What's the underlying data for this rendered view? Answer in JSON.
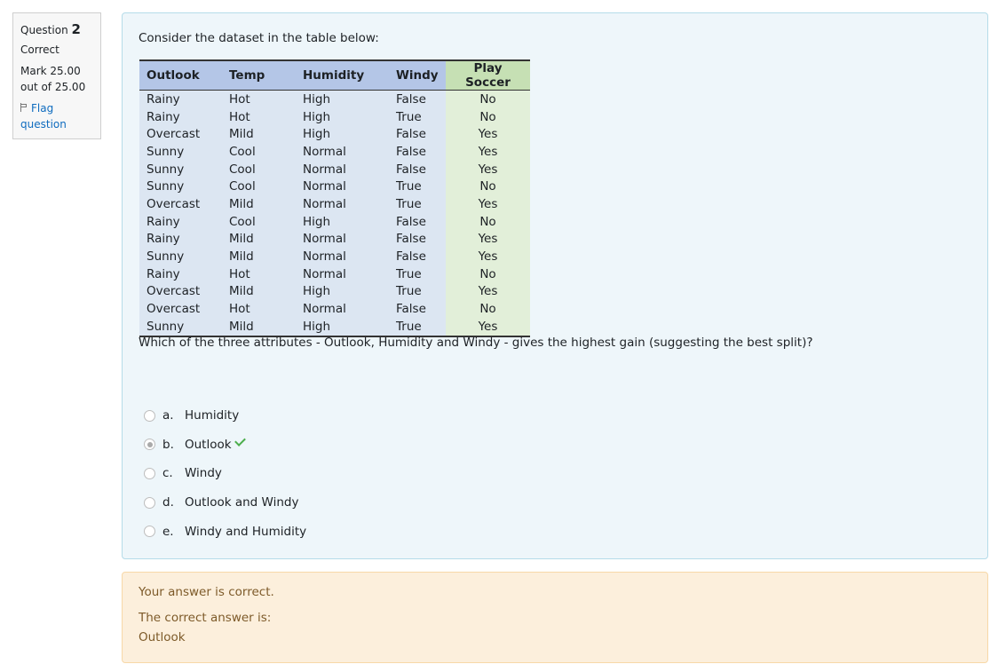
{
  "info": {
    "question_label": "Question",
    "question_number": "2",
    "state": "Correct",
    "grade": "Mark 25.00 out of 25.00",
    "flag_label": "Flag question"
  },
  "question": {
    "intro": "Consider the dataset in the table below:",
    "table": {
      "headers": [
        "Outlook",
        "Temp",
        "Humidity",
        "Windy",
        "Play Soccer"
      ],
      "rows": [
        [
          "Rainy",
          "Hot",
          "High",
          "False",
          "No"
        ],
        [
          "Rainy",
          "Hot",
          "High",
          "True",
          "No"
        ],
        [
          "Overcast",
          "Mild",
          "High",
          "False",
          "Yes"
        ],
        [
          "Sunny",
          "Cool",
          "Normal",
          "False",
          "Yes"
        ],
        [
          "Sunny",
          "Cool",
          "Normal",
          "False",
          "Yes"
        ],
        [
          "Sunny",
          "Cool",
          "Normal",
          "True",
          "No"
        ],
        [
          "Overcast",
          "Mild",
          "Normal",
          "True",
          "Yes"
        ],
        [
          "Rainy",
          "Cool",
          "High",
          "False",
          "No"
        ],
        [
          "Rainy",
          "Mild",
          "Normal",
          "False",
          "Yes"
        ],
        [
          "Sunny",
          "Mild",
          "Normal",
          "False",
          "Yes"
        ],
        [
          "Rainy",
          "Hot",
          "Normal",
          "True",
          "No"
        ],
        [
          "Overcast",
          "Mild",
          "High",
          "True",
          "Yes"
        ],
        [
          "Overcast",
          "Hot",
          "Normal",
          "False",
          "No"
        ],
        [
          "Sunny",
          "Mild",
          "High",
          "True",
          "Yes"
        ]
      ]
    },
    "prompt": "Which of the three attributes - Outlook, Humidity and Windy - gives the highest gain (suggesting the best split)?",
    "options": [
      {
        "letter": "a.",
        "text": "Humidity",
        "selected": false,
        "correct": false
      },
      {
        "letter": "b.",
        "text": "Outlook",
        "selected": true,
        "correct": true
      },
      {
        "letter": "c.",
        "text": "Windy",
        "selected": false,
        "correct": false
      },
      {
        "letter": "d.",
        "text": "Outlook and Windy",
        "selected": false,
        "correct": false
      },
      {
        "letter": "e.",
        "text": "Windy and Humidity",
        "selected": false,
        "correct": false
      }
    ]
  },
  "outcome": {
    "feedback": "Your answer is correct.",
    "right_answer_label": "The correct answer is:",
    "right_answer_value": "Outlook"
  },
  "colors": {
    "formulation_bg": "#eef6fa",
    "outcome_bg": "#fcefdc",
    "header_blue": "#b4c6e7",
    "cell_blue": "#dce6f2",
    "header_green": "#c6e0b4",
    "cell_green": "#e2efd9",
    "correct_tick": "#4cae4c"
  }
}
